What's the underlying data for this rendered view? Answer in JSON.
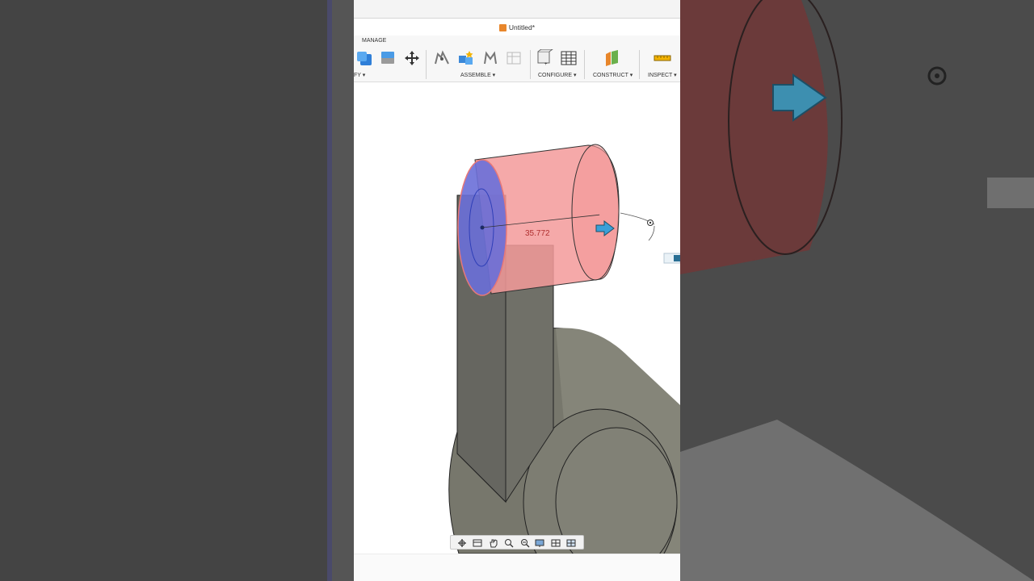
{
  "window": {
    "title": "Untitled*"
  },
  "ribbon": {
    "tab_manage": "MANAGE",
    "groups": {
      "modify": "FY ▾",
      "assemble": "ASSEMBLE ▾",
      "configure": "CONFIGURE ▾",
      "construct": "CONSTRUCT ▾",
      "inspect": "INSPECT ▾"
    }
  },
  "viewport": {
    "dimension_value": "35.772",
    "colors": {
      "extrude_body": "#f39a9a",
      "selected_face": "#6a6fd8",
      "solid": "#77776c"
    }
  },
  "icons": {
    "manage": [
      "combine-icon",
      "offset-face-icon",
      "move-icon"
    ],
    "assemble": [
      "joint-icon",
      "new-component-icon",
      "as-built-joint-icon",
      "table-icon"
    ],
    "configure": [
      "parameters-icon",
      "configure-table-icon"
    ],
    "construct": [
      "construct-plane-icon"
    ],
    "inspect": [
      "measure-icon"
    ],
    "navbar": [
      "orbit-icon",
      "look-at-icon",
      "pan-icon",
      "zoom-window-icon",
      "zoom-icon",
      "display-settings-icon",
      "grid-settings-icon",
      "viewports-icon"
    ]
  }
}
